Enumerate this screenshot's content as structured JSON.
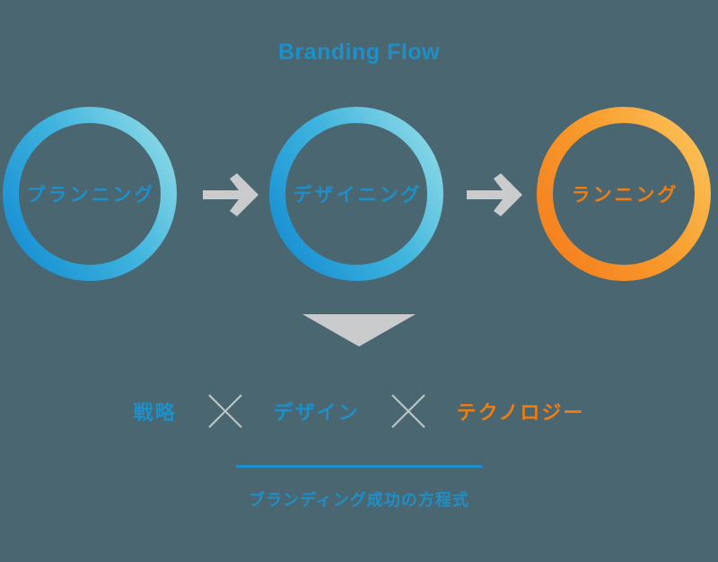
{
  "header": {
    "title": "Branding Flow"
  },
  "flow": {
    "stages": [
      {
        "label": "プランニング",
        "color": "#1d8fc9",
        "ring_from": "#1f9ad8",
        "ring_to": "#83d6e4",
        "tone": "blue"
      },
      {
        "label": "デザイニング",
        "color": "#1d8fc9",
        "ring_from": "#1f9ad8",
        "ring_to": "#83d6e4",
        "tone": "blue"
      },
      {
        "label": "ランニング",
        "color": "#f07d12",
        "ring_from": "#f58220",
        "ring_to": "#fcc158",
        "tone": "orange"
      }
    ],
    "arrow_color": "#c9cbcc",
    "arrow_1_name": "arrow-right-icon",
    "arrow_2_name": "arrow-right-icon",
    "down_arrow_color": "#c9cbcc"
  },
  "equation": {
    "terms": [
      {
        "text": "戦略",
        "color": "#1d8fc9"
      },
      {
        "text": "デザイン",
        "color": "#1d8fc9"
      },
      {
        "text": "テクノロジー",
        "color": "#f07d12"
      }
    ],
    "operator": "×",
    "operator_color": "#b9c4c6"
  },
  "conclusion": {
    "text": "ブランディング成功の方程式",
    "rule_color": "#1d8fc9"
  },
  "theme": {
    "background": "#4a6670",
    "accent_blue": "#1d8fc9",
    "accent_cyan": "#83d6e4",
    "accent_orange": "#f58220",
    "accent_orange_light": "#fcc158",
    "gray": "#c9cbcc"
  }
}
